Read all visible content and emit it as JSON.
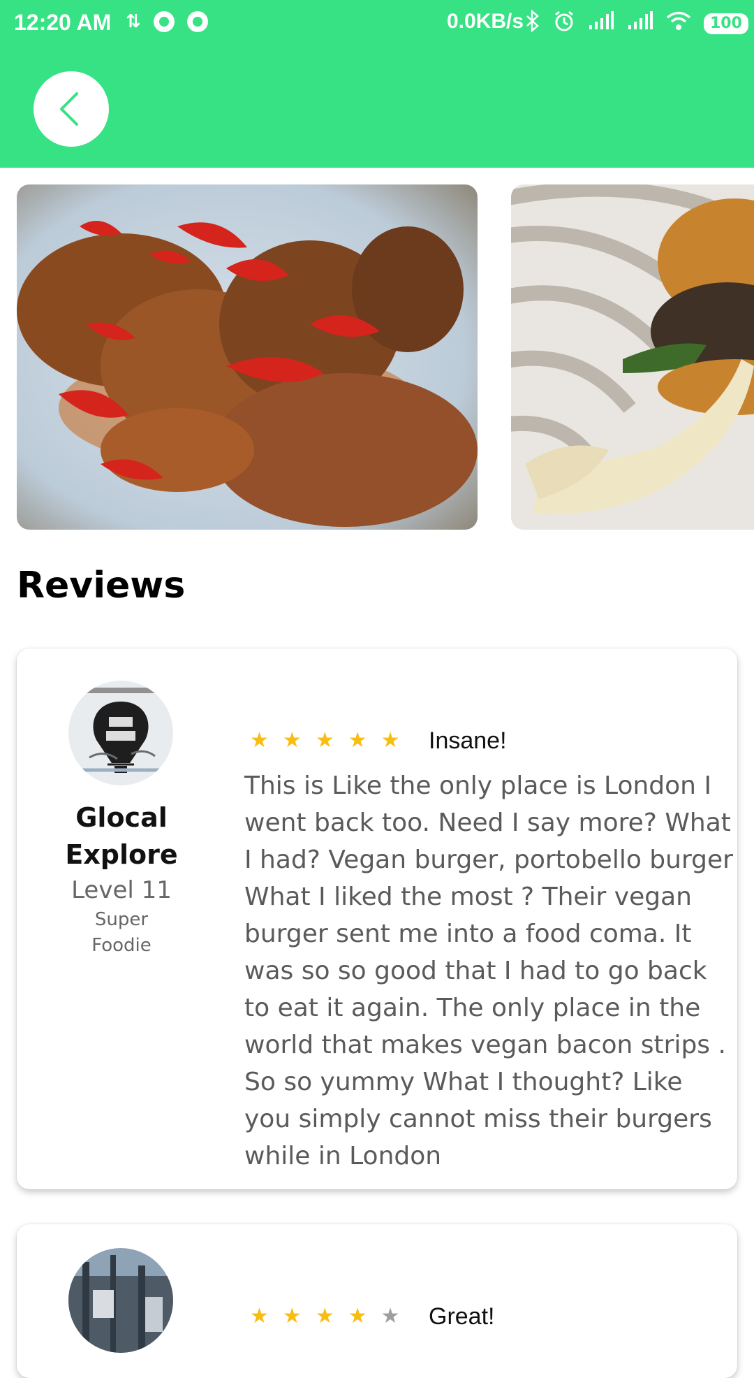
{
  "status_bar": {
    "time": "12:20 AM",
    "network_speed": "0.0KB/s",
    "battery": "100"
  },
  "header": {
    "back_icon": "chevron-left-icon",
    "accent_color": "#36e283"
  },
  "gallery": {
    "photos": [
      {
        "alt": "crispy fried chicken with red chillies"
      },
      {
        "alt": "burger with melted cheese"
      }
    ]
  },
  "reviews_section": {
    "title": "Reviews",
    "items": [
      {
        "reviewer_name": "Glocal Explore",
        "reviewer_level": "Level 11",
        "reviewer_rank": "Super Foodie",
        "rating": 5,
        "max_rating": 5,
        "headline": "Insane!",
        "text": "This is Like the only place is London I went back too. Need I say more? What I had? Vegan burger, portobello burger  What I liked the most ? Their vegan burger sent me into a food coma. It was so so good that I had to go back to eat it again. The only place in the world that makes vegan bacon strips . So so yummy   What I thought? Like you simply cannot miss their burgers while in London"
      },
      {
        "rating": 4,
        "max_rating": 5,
        "headline": "Great!"
      }
    ]
  },
  "colors": {
    "star_filled": "#f8bd12",
    "star_empty": "#9e9e9e"
  }
}
